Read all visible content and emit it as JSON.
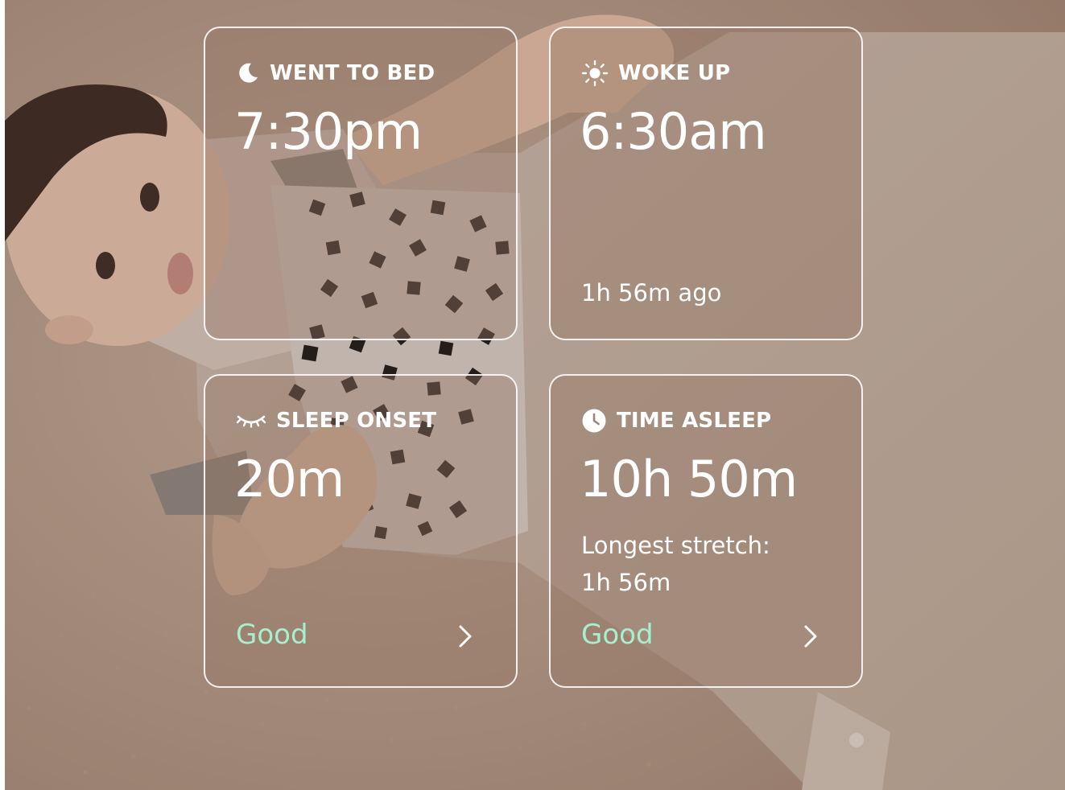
{
  "cards": {
    "went_to_bed": {
      "icon": "moon-icon",
      "label": "WENT TO BED",
      "value": "7:30pm"
    },
    "woke_up": {
      "icon": "sun-icon",
      "label": "WOKE UP",
      "value": "6:30am",
      "note": "1h 56m ago"
    },
    "sleep_onset": {
      "icon": "closed-eye-icon",
      "label": "SLEEP ONSET",
      "value": "20m",
      "status": "Good"
    },
    "time_asleep": {
      "icon": "clock-icon",
      "label": "TIME ASLEEP",
      "value": "10h 50m",
      "note_line1": "Longest stretch:",
      "note_line2": "1h 56m",
      "status": "Good"
    }
  },
  "colors": {
    "status_good": "#a6f0cd",
    "card_border": "#ffffff",
    "background": "#b49d8d"
  }
}
